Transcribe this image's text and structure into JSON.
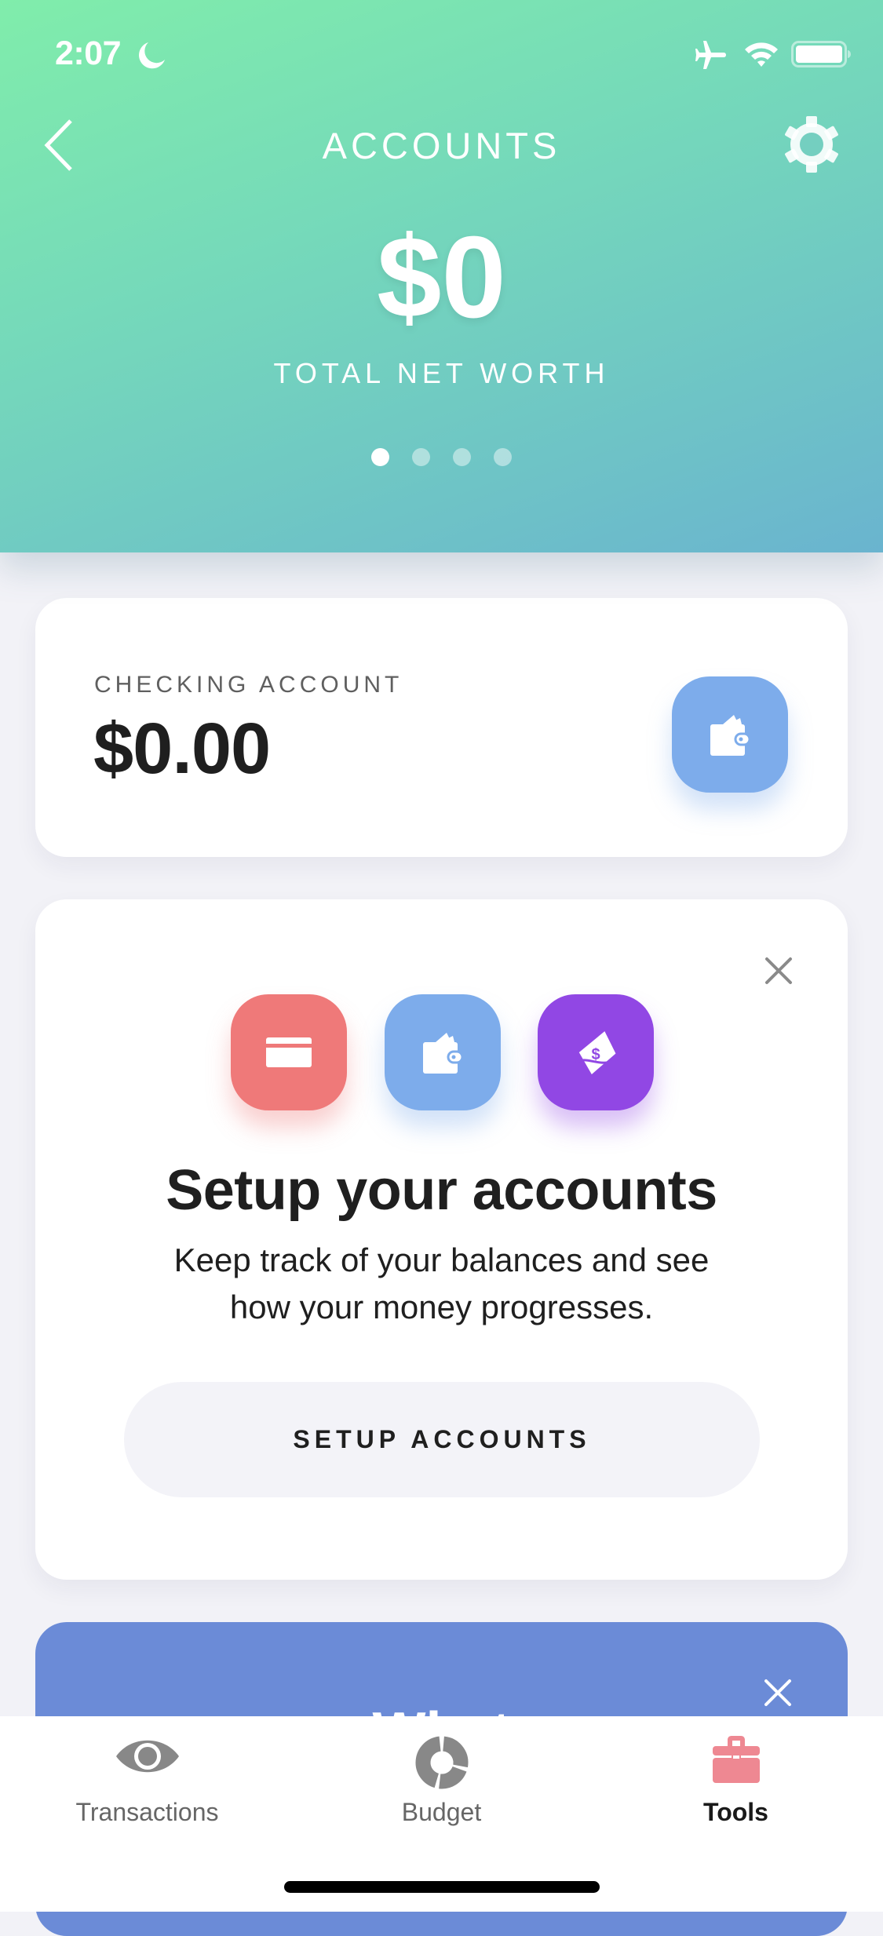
{
  "status_bar": {
    "time": "2:07",
    "icons": [
      "moon-icon",
      "airplane-icon",
      "wifi-icon",
      "battery-icon"
    ]
  },
  "header": {
    "title": "ACCOUNTS",
    "back_icon": "chevron-left-icon",
    "settings_icon": "gear-icon",
    "net_worth": "$0",
    "net_worth_label": "TOTAL NET WORTH",
    "pager": {
      "count": 4,
      "active_index": 0
    },
    "gradient": [
      "#80EDAB",
      "#6AB4CF"
    ]
  },
  "checking_card": {
    "label": "CHECKING ACCOUNT",
    "amount": "$0.00",
    "icon": "wallet-icon",
    "icon_color": "#7DACEB"
  },
  "setup_card": {
    "icons": [
      {
        "name": "credit-card-icon",
        "color": "#EF7979"
      },
      {
        "name": "wallet-icon",
        "color": "#7DACEB"
      },
      {
        "name": "cash-hand-icon",
        "color": "#9147E4"
      }
    ],
    "title": "Setup your accounts",
    "description": "Keep track of your balances and see how your money progresses.",
    "button_label": "SETUP ACCOUNTS",
    "close_icon": "close-icon"
  },
  "whatsnew_card": {
    "title": "What",
    "color": "#6B8BD7",
    "close_icon": "close-icon"
  },
  "tabbar": {
    "tabs": [
      {
        "label": "Transactions",
        "icon": "eye-icon",
        "active": false
      },
      {
        "label": "Budget",
        "icon": "donut-chart-icon",
        "active": false
      },
      {
        "label": "Tools",
        "icon": "toolbox-icon",
        "active": true
      }
    ],
    "active_color": "#EE8892"
  }
}
